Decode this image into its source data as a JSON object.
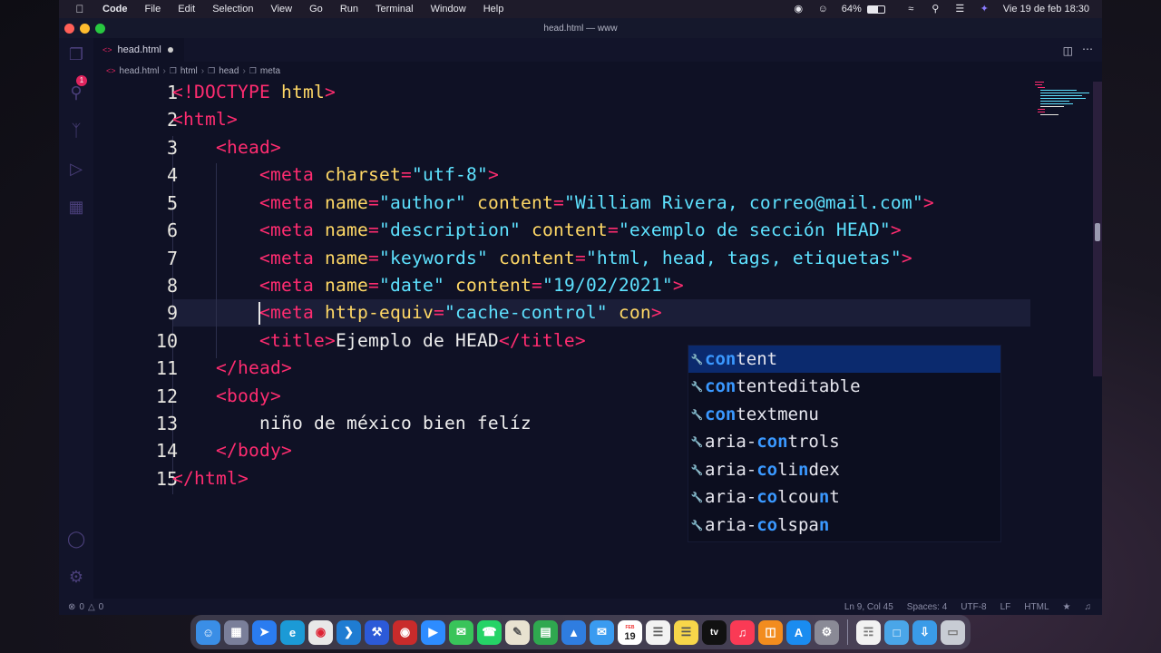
{
  "menubar": {
    "app": "Code",
    "items": [
      "File",
      "Edit",
      "Selection",
      "View",
      "Go",
      "Run",
      "Terminal",
      "Window",
      "Help"
    ],
    "battery": "64%",
    "datetime": "Vie 19 de feb  18:30"
  },
  "window": {
    "title": "head.html — www"
  },
  "activity_bar": {
    "explorer_badge": "1",
    "icons": [
      "explorer-icon",
      "search-icon",
      "source-control-icon",
      "run-debug-icon",
      "extensions-icon",
      "account-icon",
      "settings-gear-icon"
    ]
  },
  "tab": {
    "filename": "head.html"
  },
  "breadcrumb": [
    "head.html",
    "html",
    "head",
    "meta"
  ],
  "editor": {
    "lines": [
      {
        "n": "1"
      },
      {
        "n": "2"
      },
      {
        "n": "3"
      },
      {
        "n": "4"
      },
      {
        "n": "5"
      },
      {
        "n": "6"
      },
      {
        "n": "7"
      },
      {
        "n": "8"
      },
      {
        "n": "9"
      },
      {
        "n": "10"
      },
      {
        "n": "11"
      },
      {
        "n": "12"
      },
      {
        "n": "13"
      },
      {
        "n": "14"
      },
      {
        "n": "15"
      }
    ],
    "code": {
      "l1a": "<!DOCTYPE",
      "l1b": " html",
      "l1c": ">",
      "l2": "<html>",
      "l3": "<head>",
      "l4": {
        "open": "<meta",
        "attr": "charset",
        "eq": "=",
        "val": "\"utf-8\"",
        "close": ">"
      },
      "l5": {
        "open": "<meta",
        "a1": "name",
        "v1": "\"author\"",
        "a2": "content",
        "v2": "\"William Rivera, correo@mail.com\"",
        "close": ">"
      },
      "l6": {
        "open": "<meta",
        "a1": "name",
        "v1": "\"description\"",
        "a2": "content",
        "v2": "\"exemplo de sección HEAD\"",
        "close": ">"
      },
      "l7": {
        "open": "<meta",
        "a1": "name",
        "v1": "\"keywords\"",
        "a2": "content",
        "v2": "\"html, head, tags, etiquetas\"",
        "close": ">"
      },
      "l8": {
        "open": "<meta",
        "a1": "name",
        "v1": "\"date\"",
        "a2": "content",
        "v2": "\"19/02/2021\"",
        "close": ">"
      },
      "l9": {
        "open": "<meta",
        "a1": "http-equiv",
        "v1": "\"cache-control\"",
        "a2": "con",
        "close": ">"
      },
      "l10": {
        "open": "<title>",
        "text": "Ejemplo de HEAD",
        "close": "</title>"
      },
      "l11": "</head>",
      "l12": "<body>",
      "l13": "niño de méxico bien felíz",
      "l14": "</body>",
      "l15": "</html>"
    }
  },
  "suggestions": [
    {
      "pre": "",
      "hl": "con",
      "post": "tent"
    },
    {
      "pre": "",
      "hl": "con",
      "post": "tenteditable"
    },
    {
      "pre": "",
      "hl": "con",
      "post": "textmenu"
    },
    {
      "pre": "aria-",
      "hl": "con",
      "post": "trols"
    },
    {
      "pre": "aria-",
      "hl": "co",
      "mid": "li",
      "hl2": "n",
      "post": "dex"
    },
    {
      "pre": "aria-",
      "hl": "co",
      "mid": "lcou",
      "hl2": "n",
      "post": "t"
    },
    {
      "pre": "aria-",
      "hl": "co",
      "mid": "lspa",
      "hl2": "n",
      "post": ""
    }
  ],
  "statusbar": {
    "errors": "0",
    "warnings": "0",
    "position": "Ln 9, Col 45",
    "spaces": "Spaces: 4",
    "encoding": "UTF-8",
    "eol": "LF",
    "language": "HTML"
  },
  "dock": {
    "apps": [
      "finder-icon",
      "launchpad-icon",
      "safari-icon",
      "edge-icon",
      "chrome-icon",
      "vscode-icon",
      "xcode-icon",
      "photo-booth-icon",
      "zoom-icon",
      "messages-icon",
      "whatsapp-icon",
      "script-editor-icon",
      "numbers-icon",
      "keynote-icon",
      "mail-icon",
      "calendar-icon",
      "reminders-icon",
      "notes-icon",
      "apple-tv-icon",
      "music-icon",
      "books-icon",
      "app-store-icon",
      "system-preferences-icon",
      "document-icon",
      "folder-icon",
      "downloads-icon",
      "trash-icon"
    ],
    "calendar_day": "19",
    "calendar_month": "FEB"
  }
}
